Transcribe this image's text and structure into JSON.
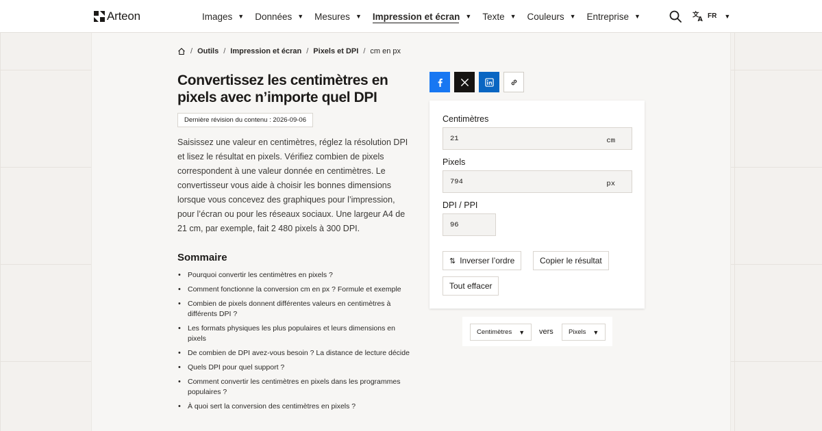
{
  "header": {
    "logo_text": "Arteon",
    "nav": [
      {
        "label": "Images",
        "active": false
      },
      {
        "label": "Données",
        "active": false
      },
      {
        "label": "Mesures",
        "active": false
      },
      {
        "label": "Impression et écran",
        "active": true
      },
      {
        "label": "Texte",
        "active": false
      },
      {
        "label": "Couleurs",
        "active": false
      },
      {
        "label": "Entreprise",
        "active": false
      }
    ],
    "search_icon": "search-icon",
    "lang_code": "FR"
  },
  "breadcrumb": {
    "items": [
      "Outils",
      "Impression et écran",
      "Pixels et DPI",
      "cm en px"
    ]
  },
  "page": {
    "title": "Convertissez les centimètres en pixels avec n’importe quel DPI",
    "revision": "Dernière révision du contenu : 2026-09-06",
    "intro": "Saisissez une valeur en centimètres, réglez la résolution DPI et lisez le résultat en pixels. Vérifiez combien de pixels correspondent à une valeur donnée en centimètres. Le convertisseur vous aide à choisir les bonnes dimensions lorsque vous concevez des graphiques pour l’impression, pour l’écran ou pour les réseaux sociaux. Une largeur A4 de 21 cm, par exemple, fait 2 480 pixels à 300 DPI.",
    "toc_title": "Sommaire",
    "toc": [
      "Pourquoi convertir les centimètres en pixels ?",
      "Comment fonctionne la conversion cm en px ? Formule et exemple",
      "Combien de pixels donnent différentes valeurs en centimètres à différents DPI ?",
      "Les formats physiques les plus populaires et leurs dimensions en pixels",
      "De combien de DPI avez-vous besoin ? La distance de lecture décide",
      "Quels DPI pour quel support ?",
      "Comment convertir les centimètres en pixels dans les programmes populaires ?",
      "À quoi sert la conversion des centimètres en pixels ?"
    ]
  },
  "share": {
    "facebook": "facebook-icon",
    "x": "x-icon",
    "linkedin": "linkedin-icon",
    "copy_link": "link-icon"
  },
  "converter": {
    "cm_label": "Centimètres",
    "cm_value": "21",
    "cm_unit": "cm",
    "px_label": "Pixels",
    "px_value": "794",
    "px_unit": "px",
    "dpi_label": "DPI / PPI",
    "dpi_value": "96",
    "swap_label": "Inverser l’ordre",
    "copy_label": "Copier le résultat",
    "clear_label": "Tout effacer"
  },
  "direction": {
    "from": "Centimètres",
    "to": "Pixels",
    "vers": "vers"
  },
  "colors": {
    "facebook": "#1877f2",
    "x": "#161412",
    "linkedin": "#0a66c2",
    "background": "#f3f1ee"
  }
}
